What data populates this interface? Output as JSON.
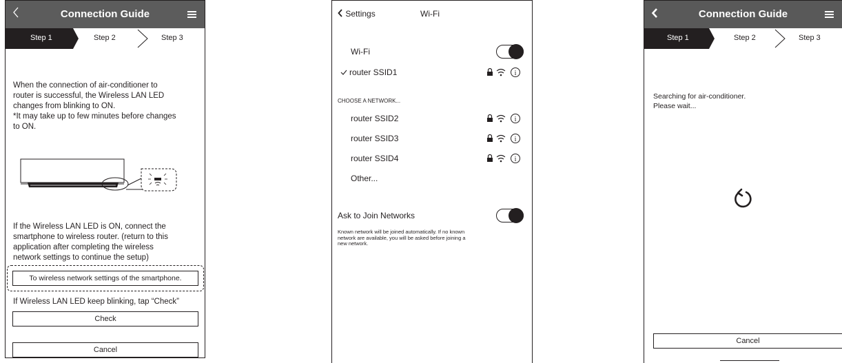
{
  "screen1": {
    "header": {
      "back_icon": "chevron-left-icon",
      "title": "Connection Guide",
      "menu_icon": "hamburger-menu-icon"
    },
    "steps": [
      "Step 1",
      "Step 2",
      "Step 3"
    ],
    "active_step": 1,
    "para1": [
      "When the connection of air-conditioner to",
      "router is successful, the Wireless LAN LED",
      "changes from blinking to  ON.",
      "*It may take up to few minutes before changes",
      "to ON."
    ],
    "para2": [
      "If the Wireless LAN LED is ON, connect the",
      "smartphone to wireless router. (return to this",
      "application after completing the wireless",
      "network settings to continue the setup)"
    ],
    "wireless_button": "To wireless network settings of the smartphone.",
    "check_hint": "If Wireless LAN LED keep blinking, tap “Check”",
    "check_button": "Check",
    "cancel_button": "Cancel"
  },
  "screen2": {
    "back_label": "Settings",
    "title": "Wi-Fi",
    "wifi_label": "Wi-Fi",
    "wifi_on": true,
    "connected": "router SSID1",
    "choose_header": "CHOOSE A NETWORK...",
    "networks": [
      "router SSID2",
      "router SSID3",
      "router SSID4"
    ],
    "other": "Other...",
    "ask_label": "Ask to Join Networks",
    "ask_on": true,
    "ask_note": [
      "Known network will be joined automatically. If no known",
      "network are available, you will be asked before joining a",
      "new network."
    ]
  },
  "screen3": {
    "header": {
      "back_icon": "chevron-left-icon",
      "title": "Connection Guide",
      "menu_icon": "hamburger-menu-icon"
    },
    "steps": [
      "Step 1",
      "Step 2",
      "Step 3"
    ],
    "active_step": 1,
    "searching": [
      "Searching for air-conditioner.",
      "Please wait..."
    ],
    "spinner_icon": "refresh-icon",
    "cancel_button": "Cancel"
  }
}
